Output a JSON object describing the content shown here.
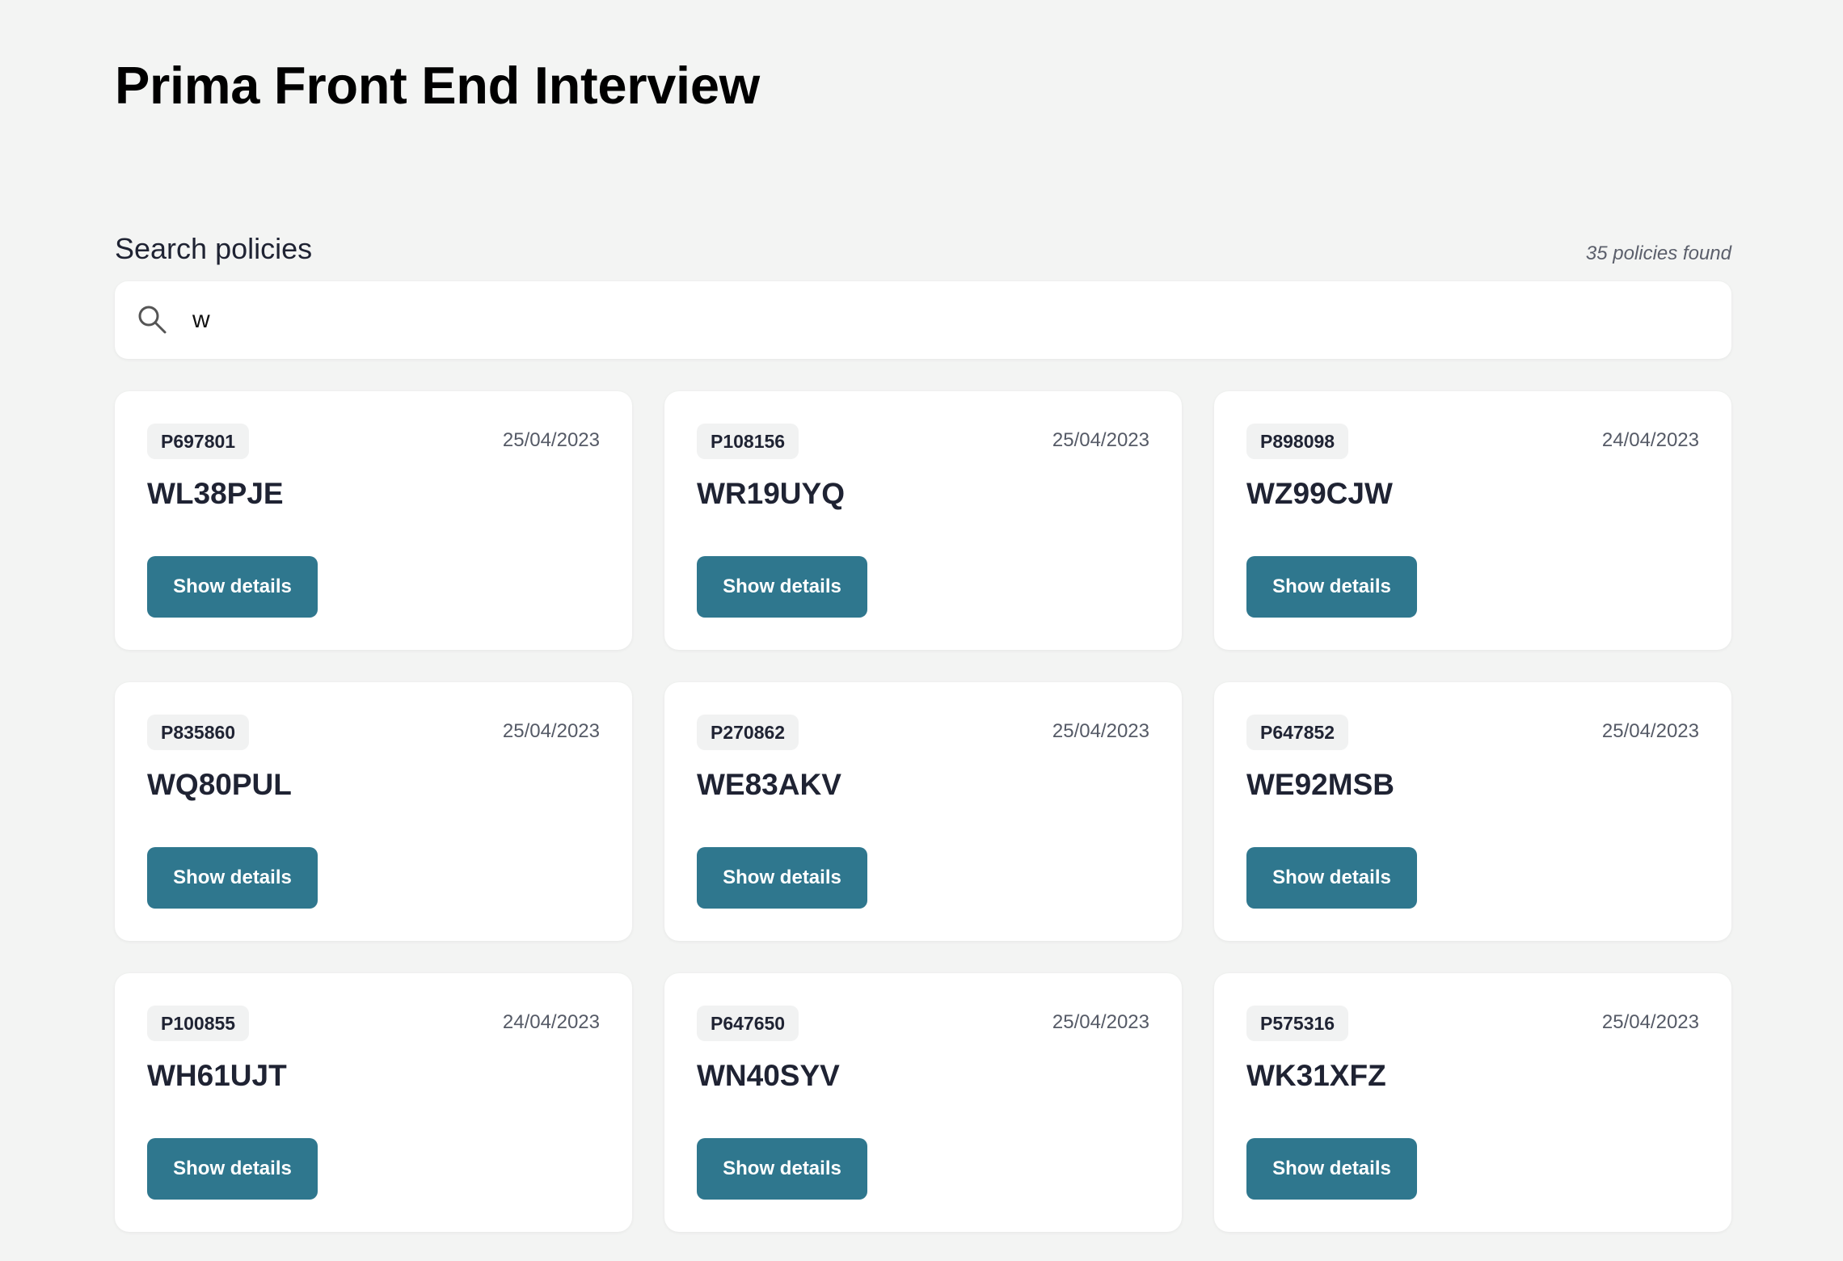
{
  "header": {
    "title": "Prima Front End Interview"
  },
  "search": {
    "label": "Search policies",
    "value": "w",
    "results_text": "35 policies found"
  },
  "policies": [
    {
      "id": "P697801",
      "date": "25/04/2023",
      "registration": "WL38PJE",
      "button_label": "Show details"
    },
    {
      "id": "P108156",
      "date": "25/04/2023",
      "registration": "WR19UYQ",
      "button_label": "Show details"
    },
    {
      "id": "P898098",
      "date": "24/04/2023",
      "registration": "WZ99CJW",
      "button_label": "Show details"
    },
    {
      "id": "P835860",
      "date": "25/04/2023",
      "registration": "WQ80PUL",
      "button_label": "Show details"
    },
    {
      "id": "P270862",
      "date": "25/04/2023",
      "registration": "WE83AKV",
      "button_label": "Show details"
    },
    {
      "id": "P647852",
      "date": "25/04/2023",
      "registration": "WE92MSB",
      "button_label": "Show details"
    },
    {
      "id": "P100855",
      "date": "24/04/2023",
      "registration": "WH61UJT",
      "button_label": "Show details"
    },
    {
      "id": "P647650",
      "date": "25/04/2023",
      "registration": "WN40SYV",
      "button_label": "Show details"
    },
    {
      "id": "P575316",
      "date": "25/04/2023",
      "registration": "WK31XFZ",
      "button_label": "Show details"
    }
  ],
  "colors": {
    "background": "#f3f4f3",
    "card": "#ffffff",
    "button": "#2f778e",
    "badge": "#f1f2f2",
    "text": "#1f2333"
  }
}
